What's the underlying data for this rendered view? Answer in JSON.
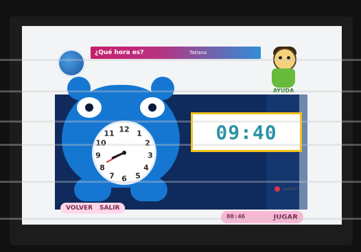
{
  "header": {
    "question": "¿Qué hora es?",
    "user": "Tatiana"
  },
  "help": {
    "label": "AYUDA"
  },
  "clock": {
    "numbers": [
      "12",
      "1",
      "2",
      "3",
      "4",
      "5",
      "6",
      "7",
      "8",
      "9",
      "10",
      "11"
    ],
    "displayed_time": "09:40"
  },
  "actions": {
    "validate": "validar",
    "back": "VOLVER",
    "exit": "SALIR",
    "play": "JUGAR"
  },
  "timer": {
    "value": "00:46"
  },
  "colors": {
    "accent_blue": "#1677d2",
    "title_pink": "#c61f6c",
    "time_text": "#2b93a4",
    "time_border": "#f2c21a"
  }
}
